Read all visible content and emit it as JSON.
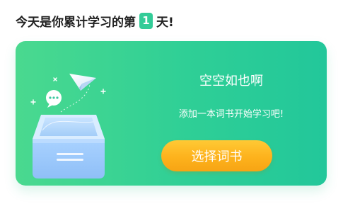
{
  "header": {
    "prefix": "今天是你累计学习的第",
    "day_count": "1",
    "suffix": "天!"
  },
  "empty_state": {
    "title": "空空如也啊",
    "message": "添加一本词书开始学习吧!",
    "button_label": "选择词书"
  },
  "colors": {
    "accent": "#33cc98",
    "card_gradient_start": "#4ad98f",
    "card_gradient_end": "#22c79a",
    "button": "#fdb21c"
  }
}
